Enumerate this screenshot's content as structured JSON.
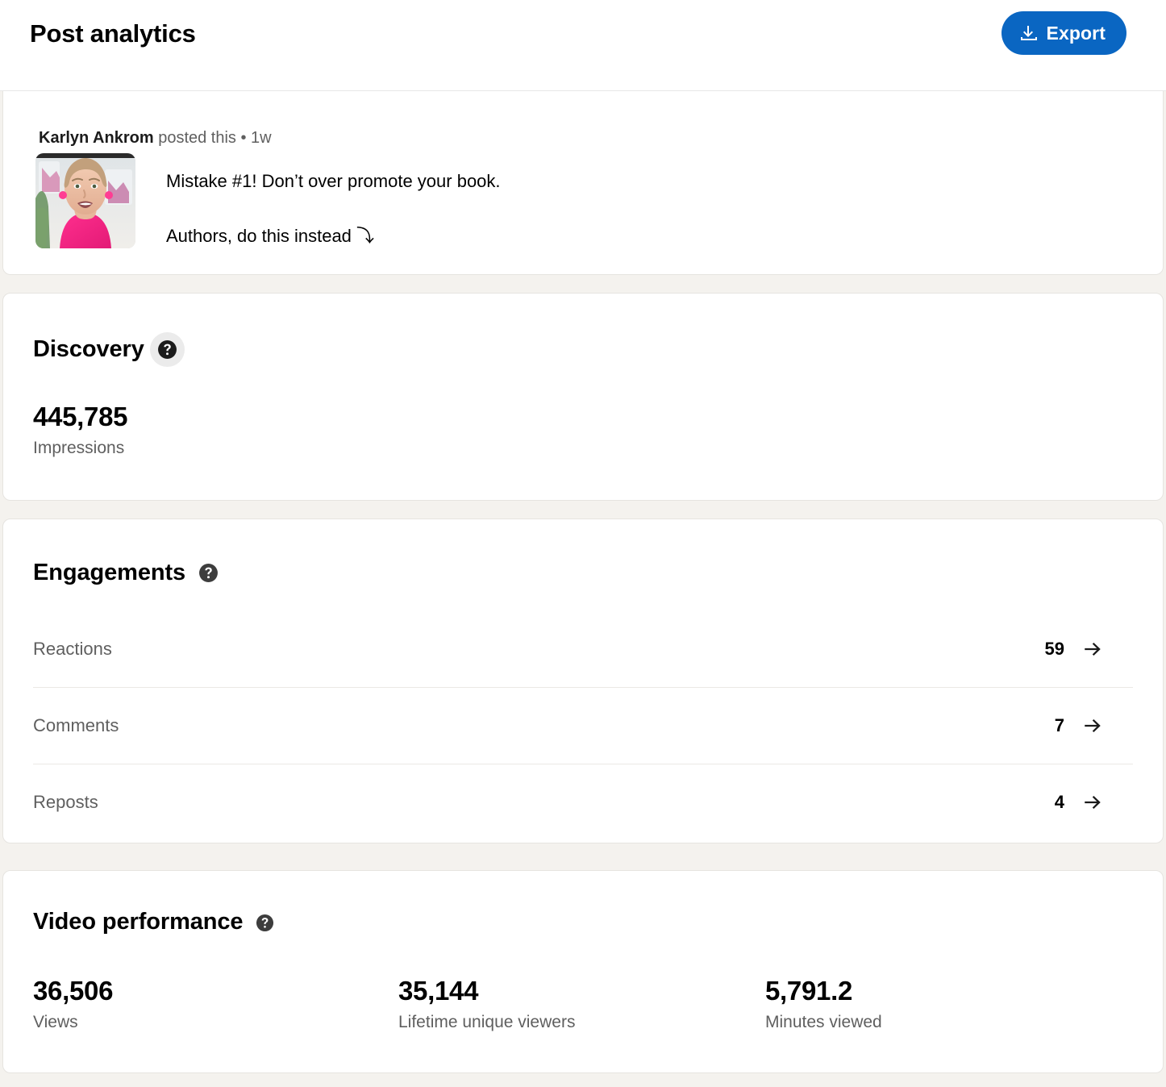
{
  "header": {
    "title": "Post analytics",
    "export_label": "Export",
    "export_icon": "download-icon",
    "accent_color": "#0a66c2"
  },
  "post": {
    "author": "Karlyn Ankrom",
    "posted_text": " posted this • 1w",
    "meta_full": "Karlyn Ankrom posted this • 1w",
    "text_line_1": "Mistake #1! Don’t over promote your book.",
    "text_line_2": "Authors, do this instead ⤵",
    "thumbnail_alt": "video-thumbnail"
  },
  "discovery": {
    "title": "Discovery",
    "help_icon": "help-circle-icon",
    "value": "445,785",
    "label": "Impressions"
  },
  "engagements": {
    "title": "Engagements",
    "help_icon": "help-circle-icon",
    "rows": [
      {
        "label": "Reactions",
        "value": "59",
        "icon": "arrow-right-icon"
      },
      {
        "label": "Comments",
        "value": "7",
        "icon": "arrow-right-icon"
      },
      {
        "label": "Reposts",
        "value": "4",
        "icon": "arrow-right-icon"
      }
    ]
  },
  "video_performance": {
    "title": "Video performance",
    "help_icon": "help-circle-icon",
    "stats": [
      {
        "value": "36,506",
        "label": "Views"
      },
      {
        "value": "35,144",
        "label": "Lifetime unique viewers"
      },
      {
        "value": "5,791.2",
        "label": "Minutes viewed"
      }
    ]
  }
}
